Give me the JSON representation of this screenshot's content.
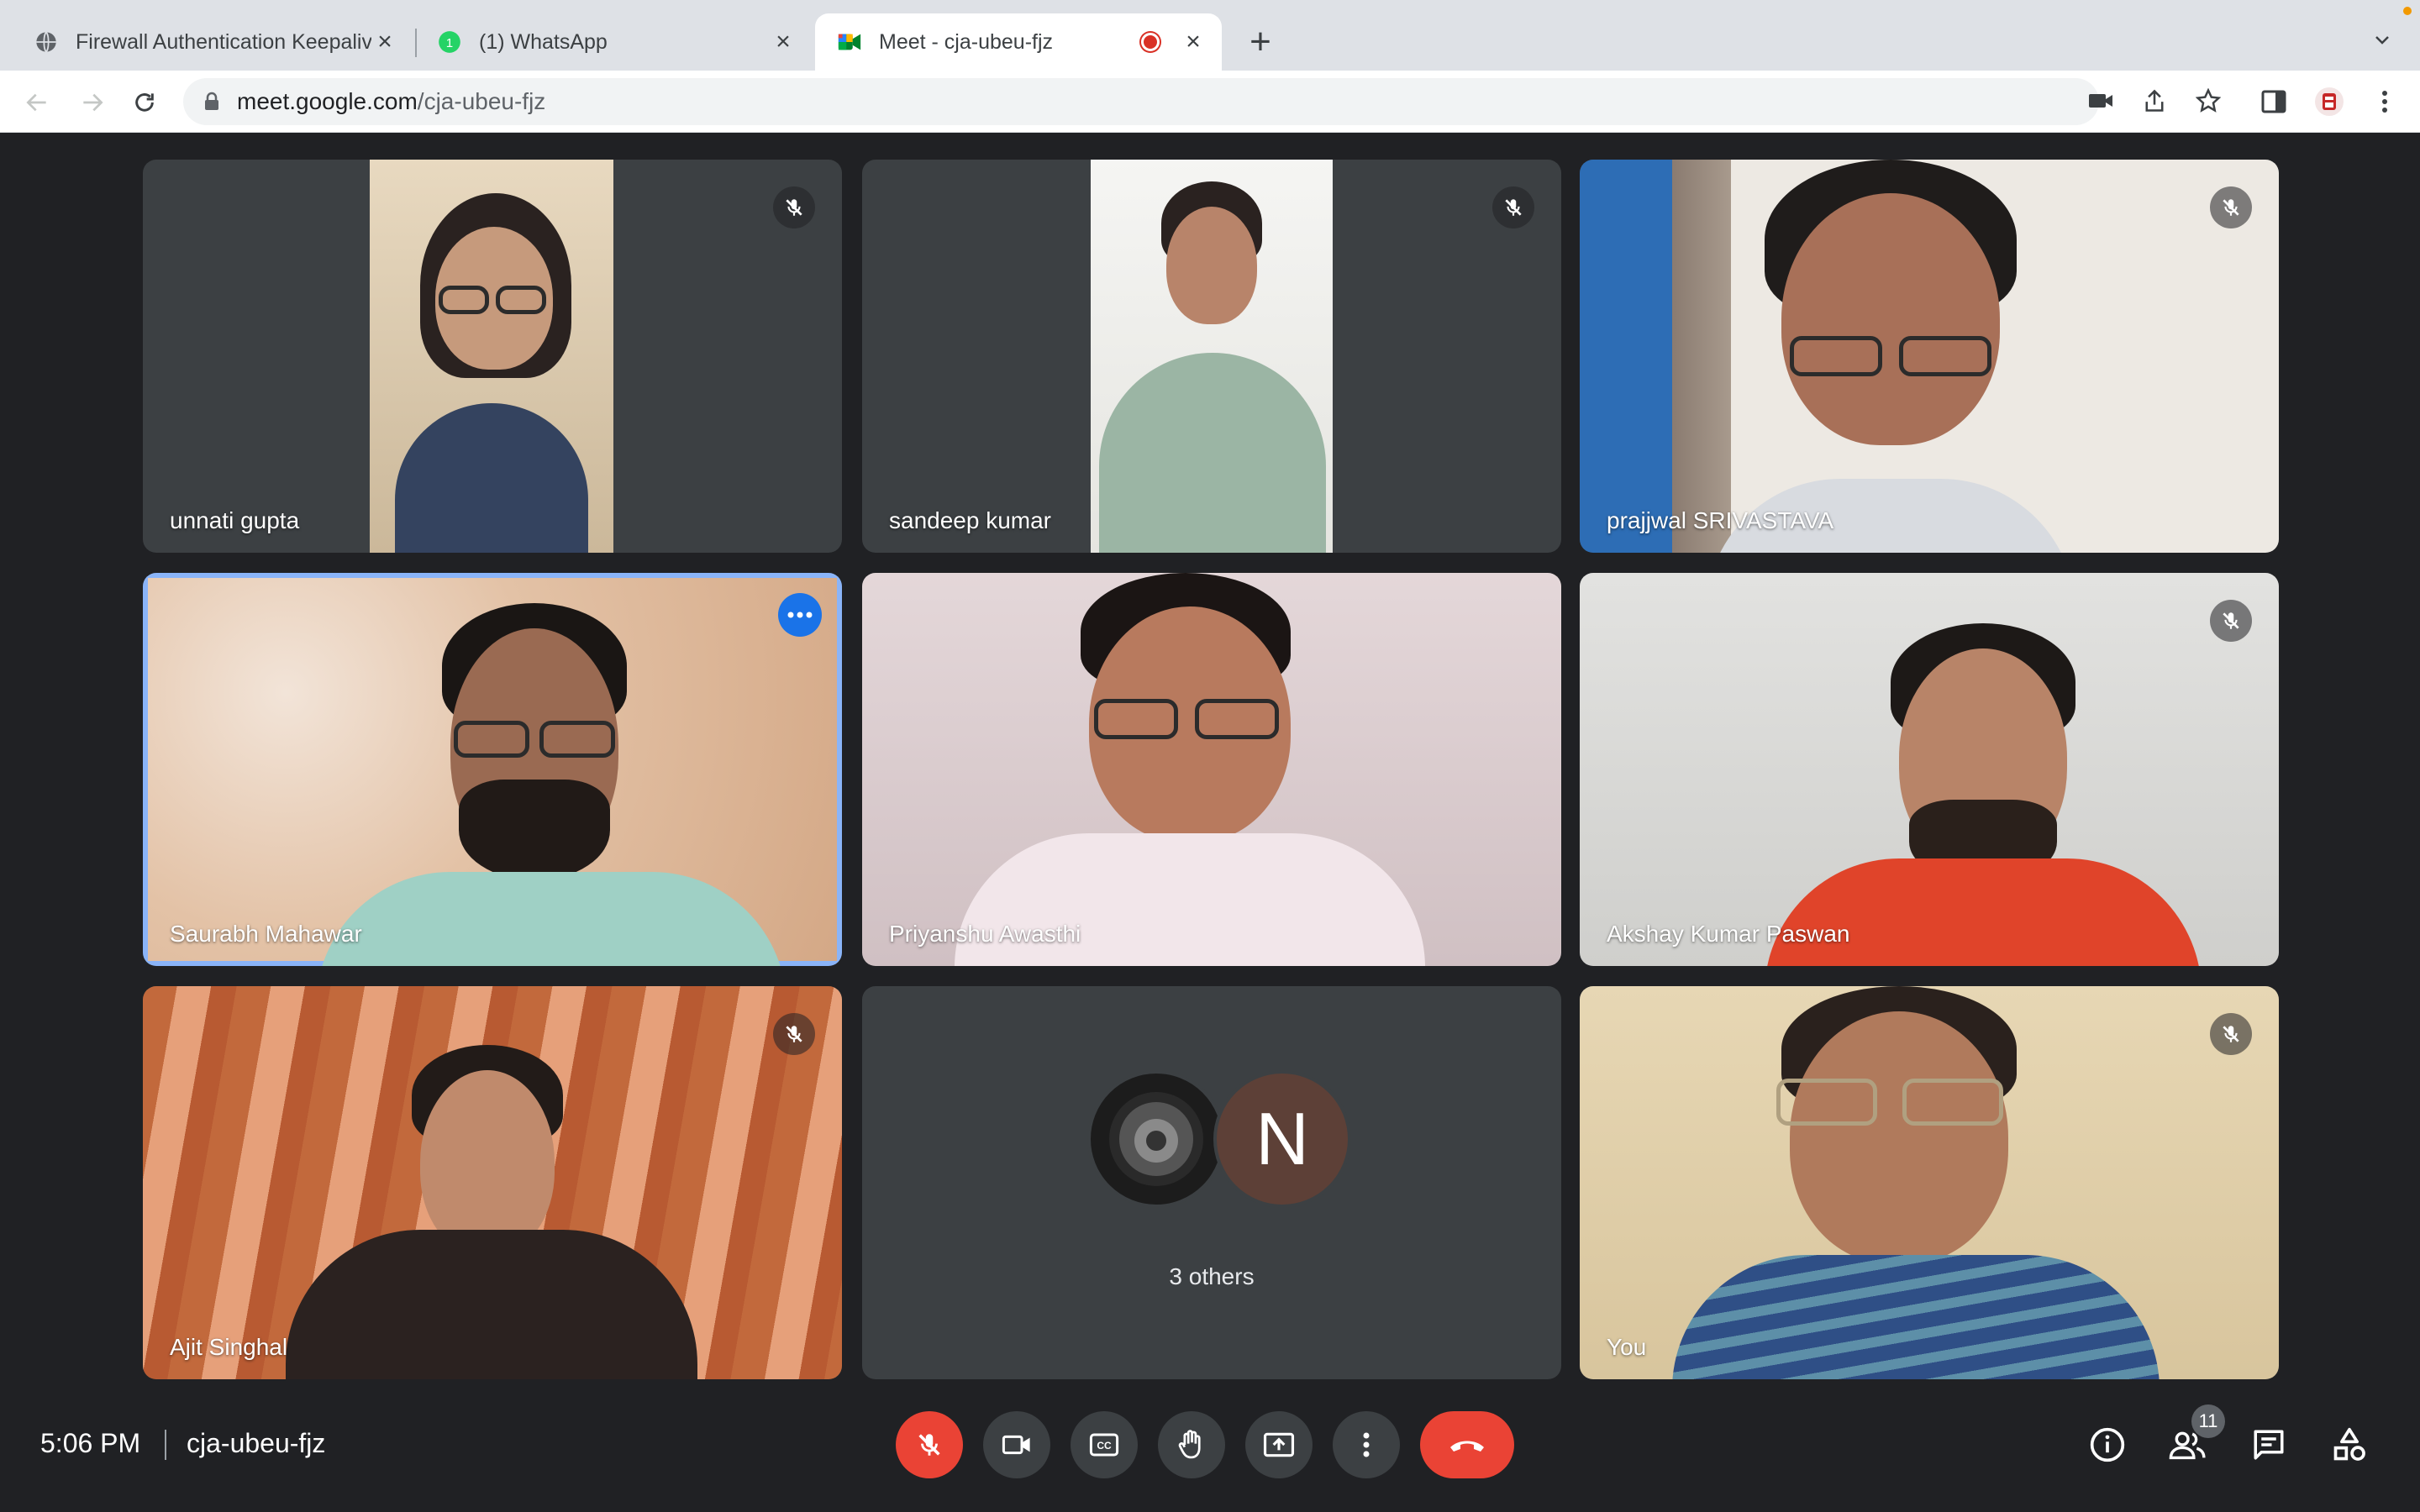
{
  "browser": {
    "tabs": [
      {
        "title": "Firewall Authentication Keepalive",
        "icon": "globe-icon"
      },
      {
        "title": "(1) WhatsApp",
        "icon": "whatsapp-icon"
      },
      {
        "title": "Meet - cja-ubeu-fjz",
        "icon": "meet-icon",
        "recording": true
      }
    ],
    "url_host": "meet.google.com",
    "url_path": "/cja-ubeu-fjz"
  },
  "participants": [
    {
      "name": "unnati gupta",
      "muted": true
    },
    {
      "name": "sandeep kumar",
      "muted": true
    },
    {
      "name": "prajjwal SRIVASTAVA",
      "muted": true
    },
    {
      "name": "Saurabh Mahawar",
      "muted": false,
      "speaking": true
    },
    {
      "name": "Priyanshu Awasthi",
      "muted": false
    },
    {
      "name": "Akshay Kumar Paswan",
      "muted": true
    },
    {
      "name": "Ajit Singhal",
      "muted": true
    },
    {
      "name": "You",
      "muted": true
    }
  ],
  "others": {
    "label": "3 others",
    "avatar_letter": "N"
  },
  "footer": {
    "time": "5:06 PM",
    "meeting_code": "cja-ubeu-fjz",
    "people_count": "11"
  },
  "colors": {
    "accent": "#1a73e8",
    "danger": "#ea4335",
    "speaking": "#8ab4f8",
    "avatar_n": "#5d4037"
  }
}
